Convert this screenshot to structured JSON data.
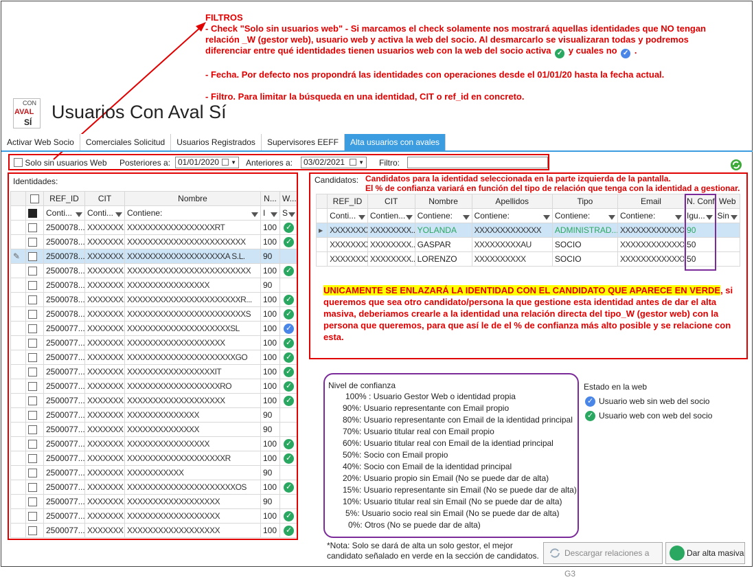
{
  "annotation_top": {
    "title": "FILTROS",
    "line1a": "- Check \"Solo sin usuarios web\" - Si marcamos el check solamente nos mostrará aquellas identidades que NO tengan",
    "line1b": "relación _W (gestor web), usuario web y activa la web del socio. Al desmarcarlo se visualizaran todas y podremos",
    "line1c_a": "diferenciar entre qué identidades tienen usuarios web con la web del socio activa",
    "line1c_b": "y cuales no",
    "line1c_c": ".",
    "line2": "- Fecha. Por defecto nos propondrá las identidades con operaciones desde el 01/01/20 hasta la fecha actual.",
    "line3": "- Filtro. Para limitar la búsqueda en una identidad, CIT o ref_id en concreto."
  },
  "logo": {
    "con": "CON",
    "aval": "AVAL",
    "si": "SÍ"
  },
  "page_title": "Usuarios Con Aval Sí",
  "tabs": [
    "Activar Web Socio",
    "Comerciales Solicitud",
    "Usuarios Registrados",
    "Supervisores EEFF",
    "Alta usuarios con avales"
  ],
  "filters": {
    "solo_sin": "Solo sin usuarios Web",
    "posteriores_label": "Posteriores a:",
    "posteriores_value": "01/01/2020",
    "anteriores_label": "Anteriores a:",
    "anteriores_value": "03/02/2021",
    "filtro_label": "Filtro:"
  },
  "identidades": {
    "label": "Identidades:",
    "headers": [
      "REF_ID",
      "CIT",
      "Nombre",
      "N...",
      "W..."
    ],
    "filter_row": [
      "Conti...",
      "Conti...",
      "Contiene:",
      "I",
      "S"
    ],
    "rows": [
      {
        "ref": "2500078...",
        "cit": "XXXXXXX...",
        "name": "XXXXXXXXXXXXXXXXXRT",
        "n": "100",
        "w": "ok"
      },
      {
        "ref": "2500078...",
        "cit": "XXXXXXX...",
        "name": "XXXXXXXXXXXXXXXXXXXXXXX",
        "n": "100",
        "w": "ok"
      },
      {
        "ref": "2500078...",
        "cit": "XXXXXXX...",
        "name": "XXXXXXXXXXXXXXXXXXXA S.L.",
        "n": "90",
        "w": ""
      },
      {
        "ref": "2500078...",
        "cit": "XXXXXXX...",
        "name": "XXXXXXXXXXXXXXXXXXXXXXXX",
        "n": "100",
        "w": "ok"
      },
      {
        "ref": "2500078...",
        "cit": "XXXXXXX...",
        "name": "XXXXXXXXXXXXXXXX",
        "n": "90",
        "w": ""
      },
      {
        "ref": "2500078...",
        "cit": "XXXXXXX...",
        "name": "XXXXXXXXXXXXXXXXXXXXXXR...",
        "n": "100",
        "w": "ok"
      },
      {
        "ref": "2500078...",
        "cit": "XXXXXXX...",
        "name": "XXXXXXXXXXXXXXXXXXXXXXXS",
        "n": "100",
        "w": "ok"
      },
      {
        "ref": "2500077...",
        "cit": "XXXXXXX...",
        "name": "XXXXXXXXXXXXXXXXXXXXSL",
        "n": "100",
        "w": "blue"
      },
      {
        "ref": "2500077...",
        "cit": "XXXXXXX...",
        "name": "XXXXXXXXXXXXXXXXXXX",
        "n": "100",
        "w": "ok"
      },
      {
        "ref": "2500077...",
        "cit": "XXXXXXX...",
        "name": "XXXXXXXXXXXXXXXXXXXXXGO",
        "n": "100",
        "w": "ok"
      },
      {
        "ref": "2500077...",
        "cit": "XXXXXXX...",
        "name": "XXXXXXXXXXXXXXXXXIT",
        "n": "100",
        "w": "ok"
      },
      {
        "ref": "2500077...",
        "cit": "XXXXXXX...",
        "name": "XXXXXXXXXXXXXXXXXXRO",
        "n": "100",
        "w": "ok"
      },
      {
        "ref": "2500077...",
        "cit": "XXXXXXX...",
        "name": "XXXXXXXXXXXXXXXXXXX",
        "n": "100",
        "w": "ok"
      },
      {
        "ref": "2500077...",
        "cit": "XXXXXXX",
        "name": "XXXXXXXXXXXXXX",
        "n": "90",
        "w": ""
      },
      {
        "ref": "2500077...",
        "cit": "XXXXXXX",
        "name": "XXXXXXXXXXXXXX",
        "n": "90",
        "w": ""
      },
      {
        "ref": "2500077...",
        "cit": "XXXXXXX...",
        "name": "XXXXXXXXXXXXXXXX",
        "n": "100",
        "w": "ok"
      },
      {
        "ref": "2500077...",
        "cit": "XXXXXXX...",
        "name": "XXXXXXXXXXXXXXXXXXXR",
        "n": "100",
        "w": "ok"
      },
      {
        "ref": "2500077...",
        "cit": "XXXXXXX",
        "name": "XXXXXXXXXXX",
        "n": "90",
        "w": ""
      },
      {
        "ref": "2500077...",
        "cit": "XXXXXXX...",
        "name": "XXXXXXXXXXXXXXXXXXXXXOS",
        "n": "100",
        "w": "ok"
      },
      {
        "ref": "2500077...",
        "cit": "XXXXXXX...",
        "name": "XXXXXXXXXXXXXXXXXX",
        "n": "90",
        "w": ""
      },
      {
        "ref": "2500077...",
        "cit": "XXXXXXX...",
        "name": "XXXXXXXXXXXXXXXXXX",
        "n": "100",
        "w": "ok"
      },
      {
        "ref": "2500077...",
        "cit": "XXXXXXX",
        "name": "XXXXXXXXXXXXXXXXXX",
        "n": "100",
        "w": "ok"
      }
    ]
  },
  "candidatos": {
    "label": "Candidatos:",
    "note1": "Candidatos para la identidad seleccionada en la parte izquierda de la pantalla.",
    "note2": "El % de confianza variará en función del tipo de relación que tenga con la identidad a gestionar.",
    "headers": [
      "REF_ID",
      "CIT",
      "Nombre",
      "Apellidos",
      "Tipo",
      "Email",
      "N. Conf.",
      "Web"
    ],
    "filter_row": [
      "Conti...",
      "Contien...",
      "Contiene:",
      "Contiene:",
      "Contiene:",
      "Contiene:",
      "Igu...",
      "Sin"
    ],
    "rows": [
      {
        "ref": "XXXXXXXX...",
        "cit": "XXXXXXXX...",
        "nombre": "YOLANDA",
        "apellidos": "XXXXXXXXXXXXX",
        "tipo": "ADMINISTRAD...",
        "email": "XXXXXXXXXXXXX...",
        "conf": "90"
      },
      {
        "ref": "XXXXXXXX...",
        "cit": "XXXXXXXX...",
        "nombre": "GASPAR",
        "apellidos": "XXXXXXXXXAU",
        "tipo": "SOCIO",
        "email": "XXXXXXXXXXXXX...",
        "conf": "50"
      },
      {
        "ref": "XXXXXXXX...",
        "cit": "XXXXXXXX...",
        "nombre": "LORENZO",
        "apellidos": "XXXXXXXXXX",
        "tipo": "SOCIO",
        "email": "XXXXXXXXXXXXX...",
        "conf": "50"
      }
    ]
  },
  "big_note": {
    "highlight": "UNICAMENTE SE ENLAZARÁ LA IDENTIDAD CON EL CANDIDATO QUE APARECE EN VERDE",
    "rest": ", si queremos que sea otro candidato/persona la que gestione esta identidad antes de dar el alta masiva, deberiamos crearle a la identidad una relación directa del tipo_W (gestor web) con la persona que queremos, para que así le de el % de confianza más alto posible y se relacione con esta."
  },
  "confianza": {
    "title": "Nivel de confianza",
    "items": [
      "100% : Usuario Gestor Web o identidad propia",
      "90%: Usuario representante con Email propio",
      "80%: Usuario representante con Email de la identidad principal",
      "70%: Usuario titular real con Email propio",
      "60%: Usuario titular real con Email de la identiad principal",
      "50%: Socio con Email propio",
      "40%: Socio con Email de la identidad principal",
      "20%: Usuario propio sin Email (No se puede dar de alta)",
      "15%: Usuario representante sin Email (No se puede dar de alta)",
      "10%: Usuario titular real sin Email (No se puede dar de alta)",
      "5%: Usuario socio real sin Email (No se puede dar de alta)",
      "0%: Otros (No se puede dar de alta)"
    ]
  },
  "estado": {
    "title": "Estado en la web",
    "sin": "Usuario web sin web del socio",
    "con": "Usuario web con web del socio"
  },
  "nota": {
    "line1": "*Nota: Solo se dará de alta un solo gestor, el mejor",
    "line2": "candidato señalado en verde en la sección de candidatos."
  },
  "buttons": {
    "descargar": "Descargar relaciones a G3",
    "alta": "Dar alta masiva"
  },
  "colors": {
    "accent": "#3c9ce0",
    "annotation": "#e00000",
    "ok": "#2aa760",
    "blue": "#4a86e8",
    "selected_row": "#cde4f7",
    "purple": "#7b2a9a"
  }
}
